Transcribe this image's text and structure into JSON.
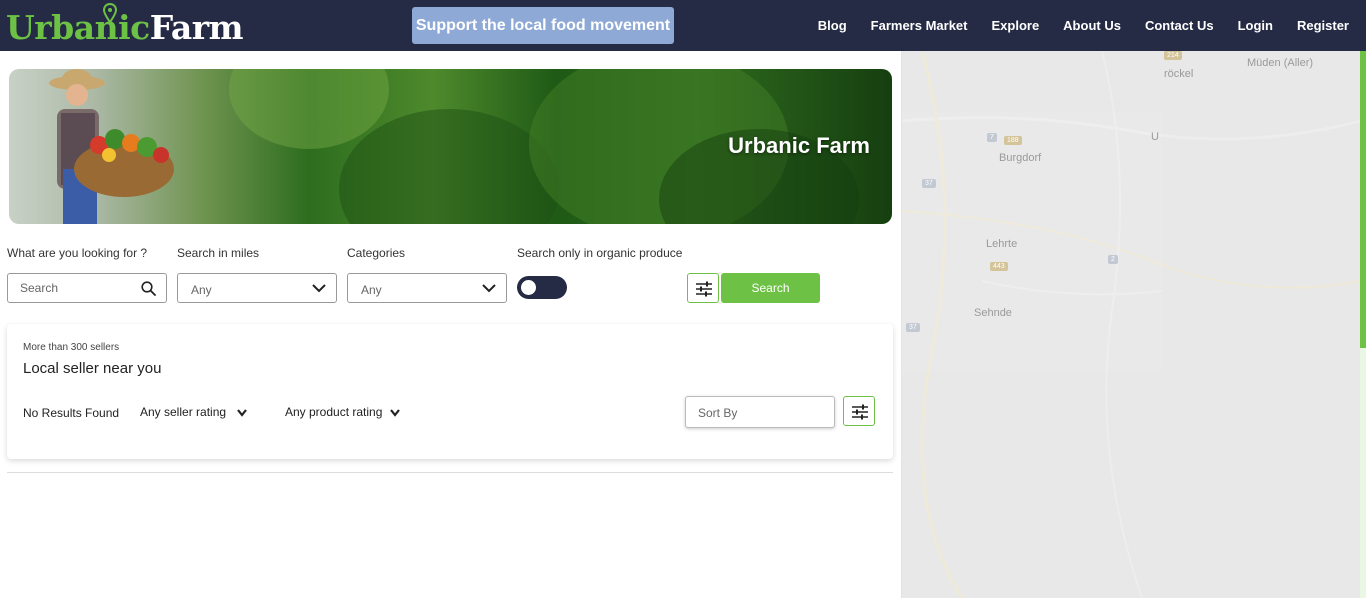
{
  "header": {
    "logo_part1": "Urbanic",
    "logo_part2": "Farm",
    "support_label": "Support the local food movement",
    "nav": [
      "Blog",
      "Farmers Market",
      "Explore",
      "About Us",
      "Contact Us",
      "Login",
      "Register"
    ]
  },
  "hero": {
    "title": "Urbanic Farm"
  },
  "filters": {
    "looking_label": "What are you looking for ?",
    "search_placeholder": "Search",
    "miles_label": "Search in miles",
    "miles_value": "Any",
    "categories_label": "Categories",
    "categories_value": "Any",
    "organic_label": "Search only in organic produce",
    "organic_enabled": false,
    "search_button": "Search"
  },
  "results": {
    "subtitle": "More than 300 sellers",
    "title": "Local seller near you",
    "status": "No Results Found",
    "seller_rating": "Any seller rating",
    "product_rating": "Any product rating",
    "sort_placeholder": "Sort By"
  },
  "map": {
    "places": [
      "Burgdorf",
      "Lehrte",
      "Sehnde",
      "Müden (Aller)",
      "röckel",
      "U"
    ],
    "road_numbers": [
      "214",
      "188",
      "37",
      "443",
      "2",
      "37",
      "7"
    ]
  },
  "colors": {
    "navbar": "#262b45",
    "accent_green": "#6dc245",
    "support_button": "#8fa9d6"
  }
}
